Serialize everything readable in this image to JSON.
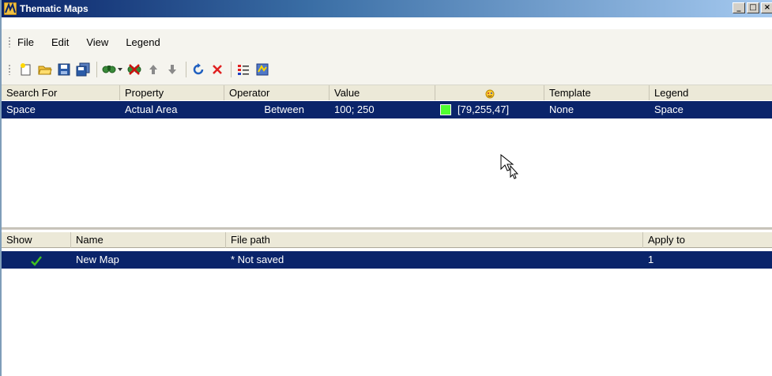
{
  "window": {
    "title": "Thematic Maps"
  },
  "window_controls": {
    "minimize": "_",
    "maximize": "□",
    "close": "×"
  },
  "menu": {
    "file": "File",
    "edit": "Edit",
    "view": "View",
    "legend": "Legend"
  },
  "toolbar": {
    "buttons": [
      "new-icon",
      "open-folder-icon",
      "save-icon",
      "save-all-icon",
      "find-icon",
      "remove-find-icon",
      "move-up-icon",
      "move-down-icon",
      "refresh-icon",
      "delete-icon",
      "legend-list-icon",
      "map-apply-icon"
    ]
  },
  "criteria_table": {
    "headers": {
      "search_for": "Search For",
      "property": "Property",
      "operator": "Operator",
      "value": "Value",
      "color_icon": "color-face-icon",
      "template": "Template",
      "legend": "Legend"
    },
    "rows": [
      {
        "search_for": "Space",
        "property": "Actual Area",
        "operator": "Between",
        "value": "100; 250",
        "color": "[79,255,47]",
        "swatch_color": "#4fff2f",
        "template": "None",
        "legend": "Space"
      }
    ]
  },
  "maps_table": {
    "headers": {
      "show": "Show",
      "name": "Name",
      "file_path": "File path",
      "apply_to": "Apply to"
    },
    "rows": [
      {
        "show": "check-icon",
        "name": "New Map",
        "file_path": "* Not saved",
        "apply_to": "1"
      }
    ]
  },
  "colors": {
    "selection": "#0a246a",
    "title_start": "#0a246a",
    "title_end": "#a6caf0"
  }
}
